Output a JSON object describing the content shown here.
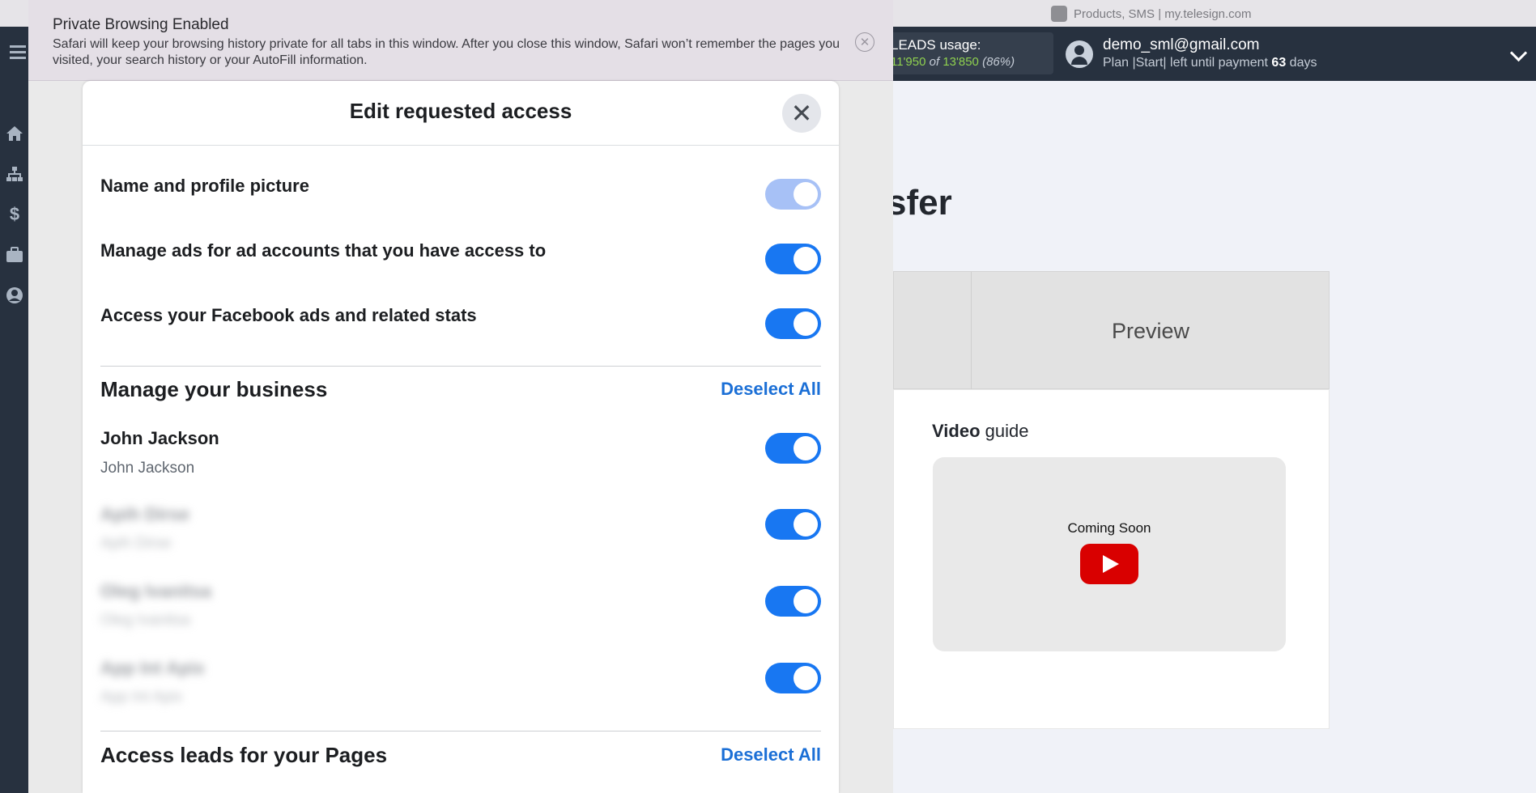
{
  "browser": {
    "site_label": "Products, SMS | my.telesign.com",
    "private_title": "Private Browsing Enabled",
    "private_desc": "Safari will keep your browsing history private for all tabs in this window. After you close this window, Safari won’t remember the pages you visited, your search history or your AutoFill information."
  },
  "header": {
    "leads_label": "LEADS usage:",
    "leads_used": "11'950",
    "leads_of": "of",
    "leads_total": "13'850",
    "leads_pct": "(86%)",
    "email": "demo_sml@gmail.com",
    "plan_prefix": "Plan |Start| left until payment",
    "plan_days": "63",
    "plan_suffix": "days"
  },
  "page": {
    "title_fragment": "sfer",
    "preview_tab": "Preview",
    "video_bold": "Video",
    "video_rest": "guide",
    "coming_soon": "Coming Soon"
  },
  "dialog": {
    "title": "Edit requested access",
    "close_symbol": "✕",
    "permissions": [
      {
        "label": "Name and profile picture",
        "enabled": true,
        "locked": true
      },
      {
        "label": "Manage ads for ad accounts that you have access to",
        "enabled": true,
        "locked": false
      },
      {
        "label": "Access your Facebook ads and related stats",
        "enabled": true,
        "locked": false
      }
    ],
    "business_section": {
      "title": "Manage your business",
      "deselect": "Deselect All",
      "items": [
        {
          "name": "John Jackson",
          "sub": "John Jackson",
          "enabled": true
        },
        {
          "name": "Apih Dirse",
          "sub": "Apih Dirse",
          "enabled": true
        },
        {
          "name": "Oleg Ivanitsa",
          "sub": "Oleg Ivanitsa",
          "enabled": true
        },
        {
          "name": "App Int Apix",
          "sub": "App Int Apix",
          "enabled": true
        }
      ]
    },
    "leads_section": {
      "title": "Access leads for your Pages",
      "deselect": "Deselect All"
    }
  },
  "colors": {
    "accent": "#1877f2",
    "link": "#1b6fd6",
    "sidebar": "#27313f",
    "leads_green": "#8fd14f"
  },
  "icons": [
    "menu-icon",
    "home-icon",
    "sitemap-icon",
    "dollar-icon",
    "briefcase-icon",
    "user-circle-icon",
    "close-icon",
    "chevron-down-icon",
    "youtube-play-icon"
  ]
}
